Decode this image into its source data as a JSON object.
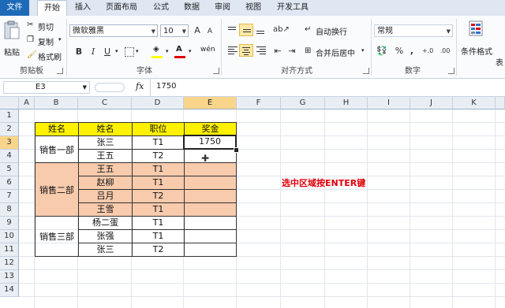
{
  "tabs": [
    "文件",
    "开始",
    "插入",
    "页面布局",
    "公式",
    "数据",
    "审阅",
    "视图",
    "开发工具"
  ],
  "clipboard": {
    "paste": "粘贴",
    "cut": "剪切",
    "copy": "复制",
    "format_painter": "格式刷",
    "group": "剪贴板"
  },
  "font": {
    "name": "微软雅黑",
    "size": "10",
    "group": "字体",
    "bold": "B",
    "italic": "I",
    "underline": "U",
    "grow": "A",
    "shrink": "A",
    "phonetic": "wén"
  },
  "alignment": {
    "wrap": "自动换行",
    "merge": "合并后居中",
    "group": "对齐方式"
  },
  "number": {
    "format": "常规",
    "percent": "%",
    "comma": ",",
    "group": "数字"
  },
  "styles": {
    "conditional": "条件格式",
    "table": "表"
  },
  "formula_bar": {
    "name_box": "E3",
    "fx": "fx",
    "value": "1750"
  },
  "columns": [
    "A",
    "B",
    "C",
    "D",
    "E",
    "F",
    "G",
    "H",
    "I",
    "J",
    "K"
  ],
  "rows": [
    "1",
    "2",
    "3",
    "4",
    "5",
    "6",
    "7",
    "8",
    "9",
    "10",
    "11",
    "12",
    "13",
    "14"
  ],
  "table": {
    "headers": [
      "姓名",
      "姓名",
      "职位",
      "奖金"
    ],
    "groups": [
      "销售一部",
      "销售二部",
      "销售三部"
    ],
    "names": [
      "张三",
      "王五",
      "王五",
      "赵柳",
      "吕月",
      "王雪",
      "杨二蛋",
      "张强",
      "张三"
    ],
    "positions": [
      "T1",
      "T2",
      "T1",
      "T1",
      "T2",
      "T1",
      "T1",
      "T1",
      "T2"
    ],
    "bonus_e3": "1750"
  },
  "annotation": "选中区域按ENTER键",
  "colors": {
    "header_fill": "#fff100",
    "group_fill": "#f8cbad",
    "annotation": "#e0000a",
    "file_tab": "#1d6bb8"
  }
}
